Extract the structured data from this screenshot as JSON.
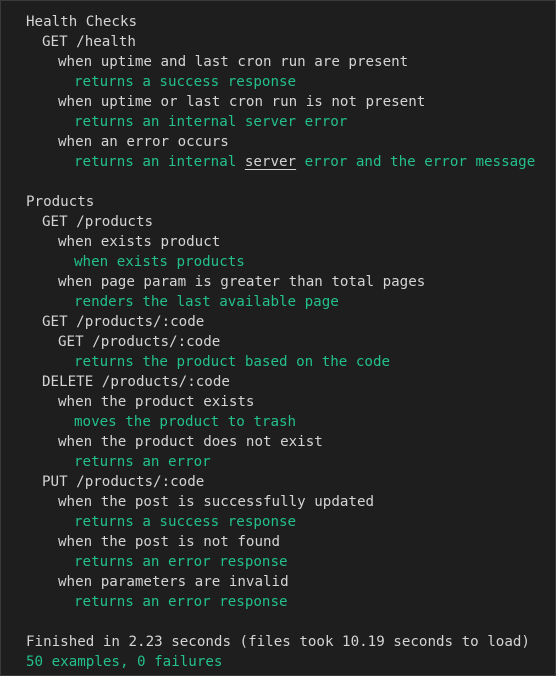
{
  "terminal": {
    "health": {
      "title": "Health Checks",
      "get_health": "GET /health",
      "ctx1": "when uptime and last cron run are present",
      "ex1": "returns a success response",
      "ctx2": "when uptime or last cron run is not present",
      "ex2": "returns an internal server error",
      "ctx3": "when an error occurs",
      "ex3_pre": "returns an internal ",
      "ex3_link": "server",
      "ex3_post": " error and the error message"
    },
    "products": {
      "title": "Products",
      "get_products": "GET /products",
      "ctx1": "when exists product",
      "ex1": "when exists products",
      "ctx2": "when page param is greater than total pages",
      "ex2": "renders the last available page",
      "get_code": "GET /products/:code",
      "get_code_inner": "GET /products/:code",
      "ex3": "returns the product based on the code",
      "delete_code": "DELETE /products/:code",
      "ctx4": "when the product exists",
      "ex4": "moves the product to trash",
      "ctx5": "when the product does not exist",
      "ex5": "returns an error",
      "put_code": "PUT /products/:code",
      "ctx6": "when the post is successfully updated",
      "ex6": "returns a success response",
      "ctx7": "when the post is not found",
      "ex7": "returns an error response",
      "ctx8": "when parameters are invalid",
      "ex8": "returns an error response"
    },
    "summary": {
      "finished": "Finished in 2.23 seconds (files took 10.19 seconds to load)",
      "result": "50 examples, 0 failures"
    }
  },
  "colors": {
    "background": "#1e1e1e",
    "text": "#d4d4d4",
    "pass": "#23c08a"
  }
}
